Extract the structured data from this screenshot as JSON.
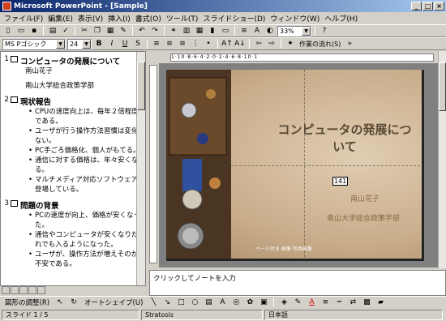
{
  "window": {
    "title": "Microsoft PowerPoint - [Sample]",
    "buttons": [
      "_",
      "□",
      "×"
    ]
  },
  "menubar": [
    "ファイル(F)",
    "編集(E)",
    "表示(V)",
    "挿入(I)",
    "書式(O)",
    "ツール(T)",
    "スライドショー(D)",
    "ウィンドウ(W)",
    "ヘルプ(H)"
  ],
  "toolbar": {
    "font_name": "MS Pゴシック",
    "font_size": "24",
    "zoom": "33%",
    "task_pane_label": "作業の流れ(S)"
  },
  "outline": {
    "slides": [
      {
        "num": "1",
        "title": "コンピュータの発展について",
        "subtitles": [
          "南山花子",
          "南山大学総合政策学部"
        ],
        "bullets": []
      },
      {
        "num": "2",
        "title": "現状報告",
        "subtitles": [],
        "bullets": [
          "CPUの速度向上は、毎年２倍程度である。",
          "ユーザが行う操作方法習慣は変化がない。",
          "PC手ごろ価格化、個人がもてる。",
          "通信に対する価格は、年々安くなる。",
          "マルチメディア対応ソフトウェアが登場している。"
        ]
      },
      {
        "num": "3",
        "title": "問題の背景",
        "subtitles": [],
        "bullets": [
          "PCの速度が向上、価格が安くなった。",
          "通信やコンピュータが安くなりだれでも入るようになった。",
          "ユーザが、操作方法が増えそのかが不安である。"
        ]
      }
    ]
  },
  "slide": {
    "title": "コンピュータの発展について",
    "author": "南山花子",
    "affiliation": "南山大学総合政策学部",
    "credit": "ページ付き 画像 写真画像",
    "cursor_label": "141"
  },
  "notes": {
    "placeholder": "クリックしてノートを入力"
  },
  "drawbar": {
    "draw_label": "図形の調整(R)",
    "autoshape_label": "オートシェイプ(U)"
  },
  "statusbar": {
    "slide_info": "スライド 1 / 5",
    "design": "Stratosis",
    "language": "日本語"
  },
  "colors": {
    "titlebar_start": "#0a246a",
    "titlebar_end": "#a6caf0",
    "slide_title": "#5a4a35",
    "slide_text": "#8a6a40"
  }
}
